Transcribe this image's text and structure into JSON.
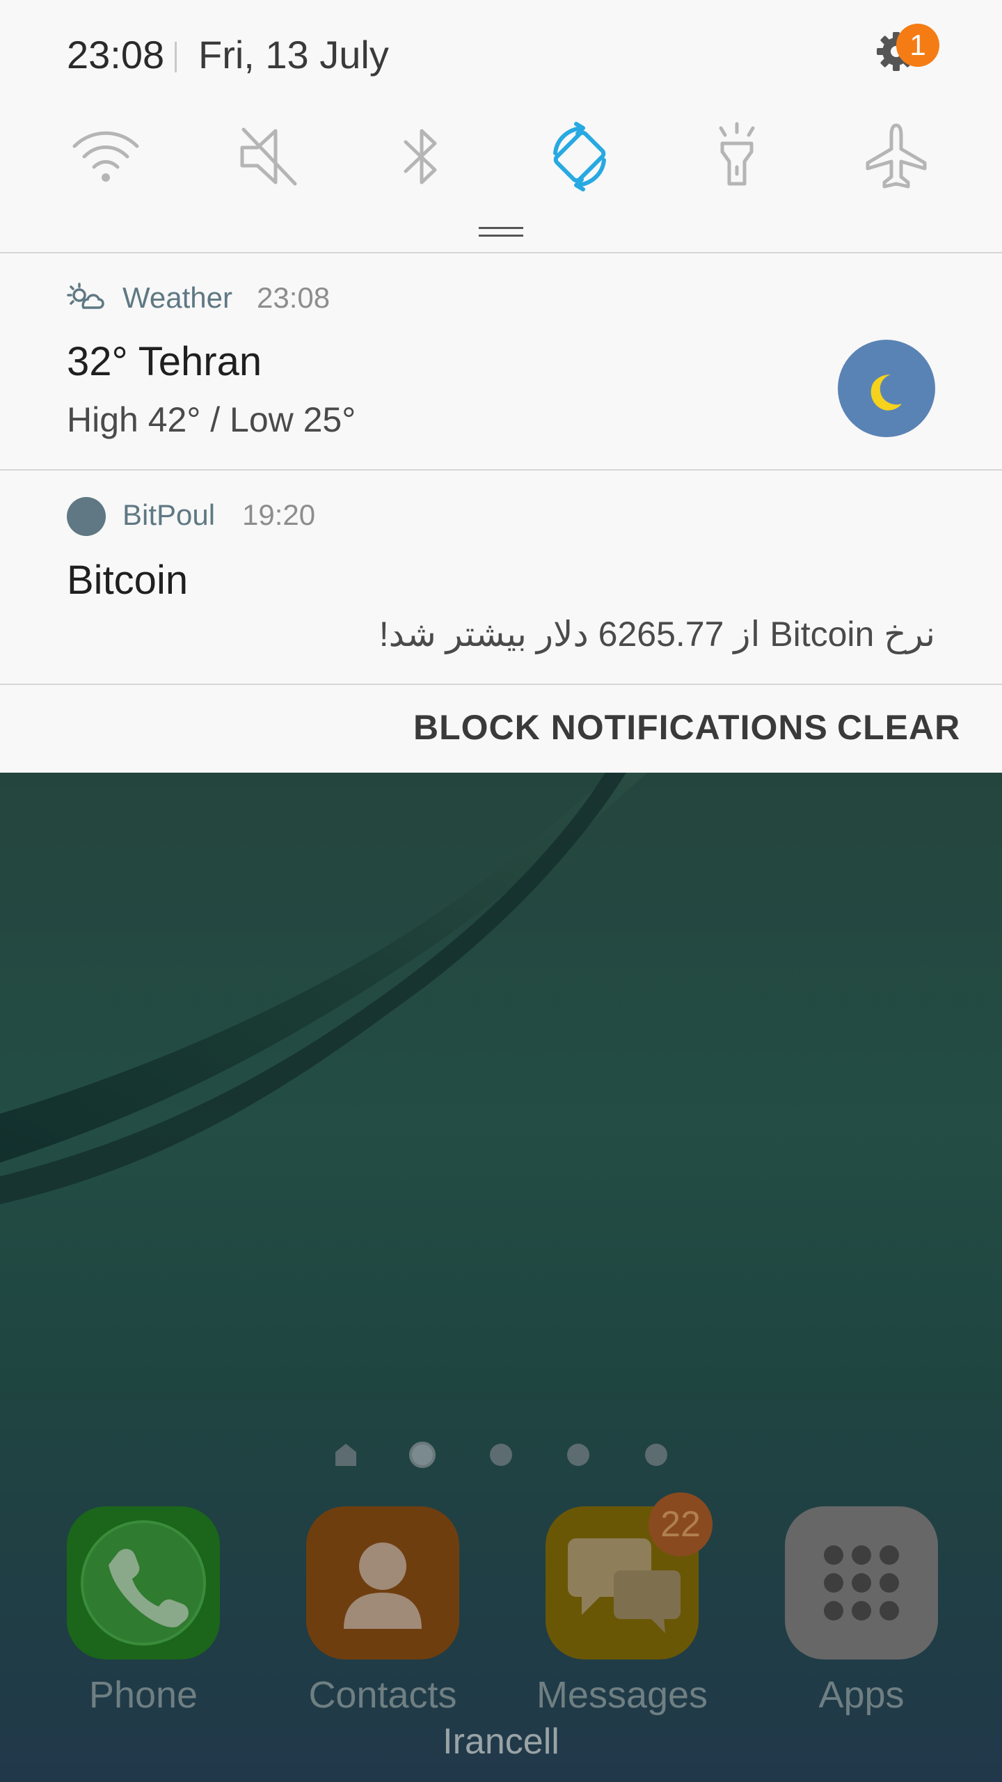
{
  "status_bar": {
    "time": "23:08",
    "date": "Fri, 13 July",
    "settings_badge": "1"
  },
  "quick_settings": {
    "tiles": [
      {
        "name": "wifi-icon",
        "active": false
      },
      {
        "name": "mute-icon",
        "active": false
      },
      {
        "name": "bluetooth-icon",
        "active": false
      },
      {
        "name": "auto-rotate-icon",
        "active": true
      },
      {
        "name": "flashlight-icon",
        "active": false
      },
      {
        "name": "airplane-mode-icon",
        "active": false
      }
    ],
    "active_color": "#27a9e1",
    "inactive_color": "#9e9e9e"
  },
  "notifications": {
    "weather": {
      "app": "Weather",
      "time": "23:08",
      "title": "32° Tehran",
      "text": "High 42° / Low 25°",
      "icon": "moon-icon"
    },
    "bitpoul": {
      "app": "BitPoul",
      "time": "19:20",
      "title": "Bitcoin",
      "text": "نرخ Bitcoin از 6265.77 دلار بیشتر شد!"
    },
    "actions": {
      "block": "BLOCK NOTIFICATIONS",
      "clear": "CLEAR"
    }
  },
  "home": {
    "dock": [
      {
        "label": "Phone",
        "icon": "phone-icon",
        "color": "#1b6a1b"
      },
      {
        "label": "Contacts",
        "icon": "contact-icon",
        "color": "#7a4210"
      },
      {
        "label": "Messages",
        "icon": "messages-icon",
        "color": "#6e5a06",
        "badge": "22"
      },
      {
        "label": "Apps",
        "icon": "apps-grid-icon",
        "color": "#6c6c6c"
      }
    ],
    "carrier": "Irancell"
  }
}
